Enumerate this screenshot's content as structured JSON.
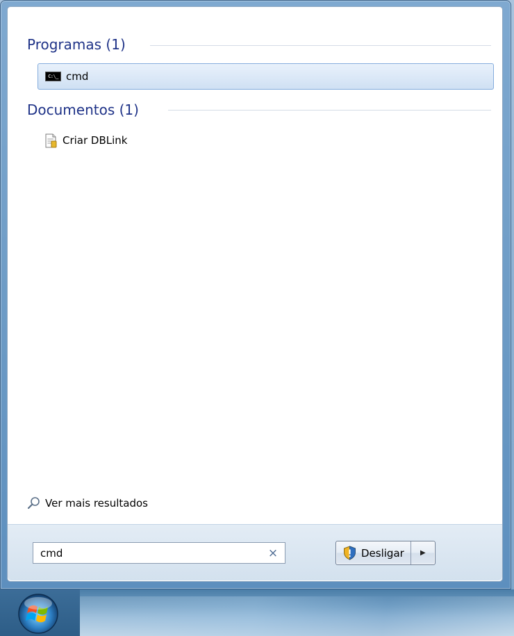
{
  "groups": {
    "programs": {
      "title": "Programas (1)"
    },
    "documents": {
      "title": "Documentos (1)"
    }
  },
  "programs": [
    {
      "label": "cmd",
      "icon": "command-prompt-icon",
      "selected": true
    }
  ],
  "documents": [
    {
      "label": "Criar DBLink",
      "icon": "text-document-icon"
    }
  ],
  "more_results": {
    "label": "Ver mais resultados",
    "icon": "search-icon"
  },
  "search": {
    "value": "cmd",
    "clear_icon": "×"
  },
  "shutdown": {
    "label": "Desligar",
    "icon": "shield-warning-icon",
    "arrow": "▶"
  },
  "colors": {
    "group_title": "#1e3287",
    "selection_border": "#84acdd",
    "selection_fill": "#dbe8f7"
  }
}
